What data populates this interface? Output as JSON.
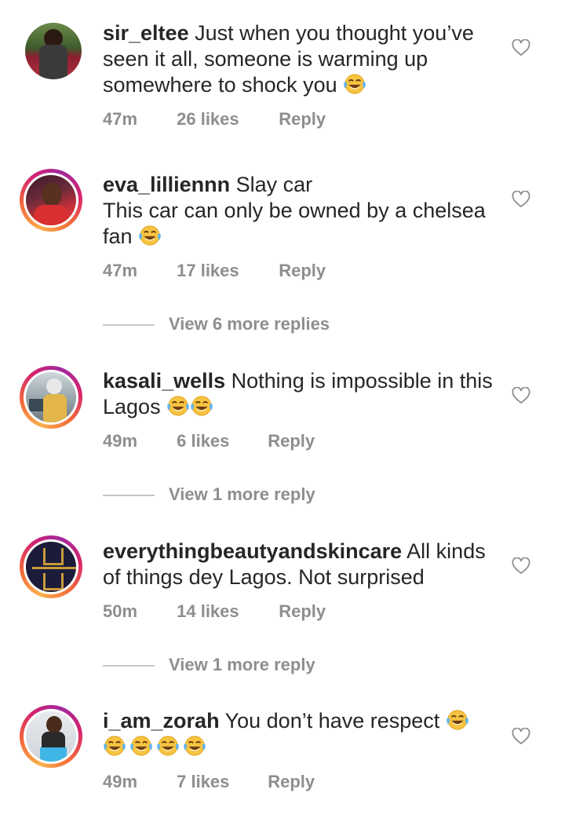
{
  "comments": [
    {
      "username": "sir_eltee",
      "text": "Just when you thought you’ve seen it all, someone is warming up somewhere to shock you",
      "emoji_count": 1,
      "time": "47m",
      "likes": "26 likes",
      "reply": "Reply"
    },
    {
      "username": "eva_lilliennn",
      "text_line1": "Slay car",
      "text_line2": "This car can only be owned by a chelsea fan",
      "emoji_count": 1,
      "time": "47m",
      "likes": "17 likes",
      "reply": "Reply",
      "view_replies": "View 6 more replies"
    },
    {
      "username": "kasali_wells",
      "text": "Nothing is impossible in this Lagos",
      "emoji_count": 2,
      "time": "49m",
      "likes": "6 likes",
      "reply": "Reply",
      "view_replies": "View 1 more reply"
    },
    {
      "username": "everythingbeautyandskincare",
      "text": "All kinds of things dey Lagos. Not surprised",
      "time": "50m",
      "likes": "14 likes",
      "reply": "Reply",
      "view_replies": "View 1 more reply"
    },
    {
      "username": "i_am_zorah",
      "text": "You don’t have respect",
      "emoji_count": 5,
      "time": "49m",
      "likes": "7 likes",
      "reply": "Reply"
    }
  ],
  "colors": {
    "text": "#262626",
    "muted": "#8e8e8e",
    "ring_start": "#f9b04c",
    "ring_end": "#d6246e"
  },
  "icons": {
    "like": "heart-outline-icon",
    "emoji": "face-with-tears-of-joy-emoji"
  }
}
